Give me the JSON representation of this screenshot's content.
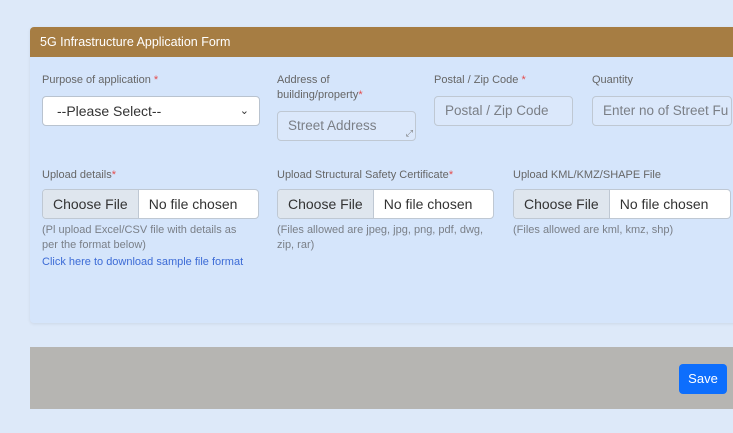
{
  "form": {
    "title": "5G Infrastructure Application Form",
    "required_mark": "*",
    "purpose": {
      "label": "Purpose of application",
      "value": "--Please Select--"
    },
    "address": {
      "label_line1": "Address of",
      "label_line2": "building/property",
      "placeholder": "Street Address"
    },
    "postal": {
      "label": "Postal / Zip Code",
      "placeholder": "Postal / Zip Code"
    },
    "quantity": {
      "label": "Quantity",
      "placeholder": "Enter no of Street Fu"
    },
    "upload_details": {
      "label": "Upload details",
      "button": "Choose File",
      "file_name": "No file chosen",
      "help_line1": "(Pl upload Excel/CSV file with details as",
      "help_line2": "per the format below)",
      "link": "Click here to download sample file format"
    },
    "safety_cert": {
      "label": "Upload Structural Safety Certificate",
      "button": "Choose File",
      "file_name": "No file chosen",
      "help_line1": "(Files allowed are jpeg, jpg, png, pdf, dwg,",
      "help_line2": "zip, rar)"
    },
    "kml": {
      "label": "Upload KML/KMZ/SHAPE File",
      "button": "Choose File",
      "file_name": "No file chosen",
      "help": "(Files allowed are kml, kmz, shp)"
    }
  },
  "footer": {
    "save_label": "Save"
  }
}
